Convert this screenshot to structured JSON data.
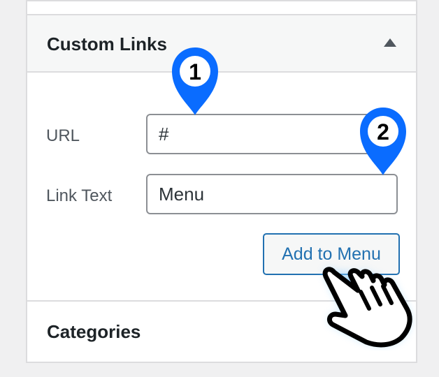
{
  "sections": {
    "custom_links": {
      "title": "Custom Links",
      "url_label": "URL",
      "url_value": "#",
      "link_text_label": "Link Text",
      "link_text_value": "Menu",
      "add_button_label": "Add to Menu"
    },
    "categories": {
      "title": "Categories"
    }
  },
  "markers": [
    {
      "label": "1"
    },
    {
      "label": "2"
    }
  ],
  "colors": {
    "accent": "#2271b1",
    "marker": "#0a6cff",
    "border": "#dcdcde",
    "header_bg": "#f6f7f7"
  },
  "icons": {
    "toggle": "triangle-up-icon",
    "cursor": "hand-pointer-icon",
    "marker": "map-pin-icon"
  }
}
